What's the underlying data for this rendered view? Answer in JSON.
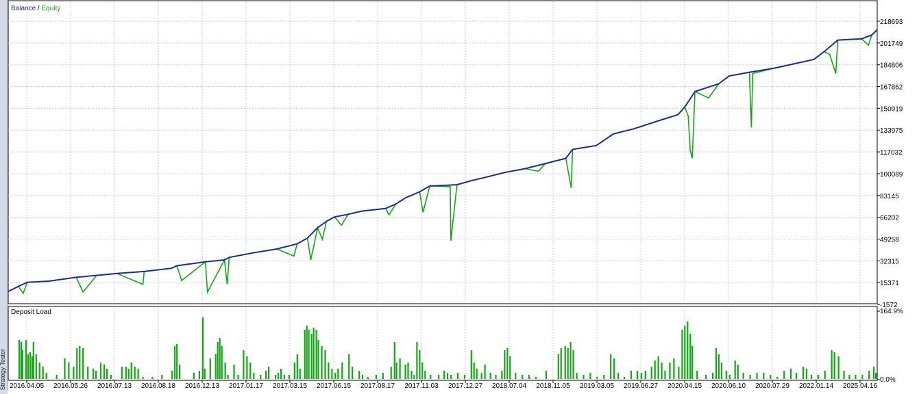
{
  "side_label": "Strategy Tester",
  "colors": {
    "balance": "#1d2d8f",
    "equity": "#12a812",
    "grid": "#c8c8c8",
    "axis": "#000000",
    "background": "#ffffff"
  },
  "chart_data": [
    {
      "type": "line",
      "legend": {
        "balance_label": "Balance",
        "separator": " / ",
        "equity_label": "Equity",
        "placement": "top-left"
      },
      "y_ticks": [
        "218693",
        "201749",
        "184806",
        "167862",
        "150919",
        "133975",
        "117032",
        "100089",
        "83145",
        "66202",
        "49258",
        "32315",
        "15371",
        "-1572"
      ],
      "ylim": [
        -1572,
        218693
      ],
      "grid": true,
      "series": [
        {
          "name": "Balance",
          "points": [
            [
              0,
              8500
            ],
            [
              15,
              12500
            ],
            [
              28,
              15600
            ],
            [
              60,
              16500
            ],
            [
              100,
              19500
            ],
            [
              130,
              21000
            ],
            [
              160,
              22500
            ],
            [
              200,
              24000
            ],
            [
              240,
              26500
            ],
            [
              248,
              28500
            ],
            [
              290,
              31500
            ],
            [
              318,
              33000
            ],
            [
              325,
              35000
            ],
            [
              360,
              38500
            ],
            [
              395,
              41500
            ],
            [
              425,
              45500
            ],
            [
              440,
              50000
            ],
            [
              455,
              58000
            ],
            [
              468,
              63000
            ],
            [
              480,
              66500
            ],
            [
              500,
              68500
            ],
            [
              520,
              71000
            ],
            [
              555,
              73000
            ],
            [
              570,
              76500
            ],
            [
              585,
              81500
            ],
            [
              605,
              86000
            ],
            [
              620,
              90500
            ],
            [
              660,
              91500
            ],
            [
              680,
              94500
            ],
            [
              700,
              97000
            ],
            [
              730,
              101000
            ],
            [
              760,
              104000
            ],
            [
              790,
              108000
            ],
            [
              820,
              112000
            ],
            [
              830,
              119000
            ],
            [
              865,
              122000
            ],
            [
              890,
              131000
            ],
            [
              920,
              135000
            ],
            [
              955,
              141000
            ],
            [
              985,
              146000
            ],
            [
              995,
              152000
            ],
            [
              1010,
              164000
            ],
            [
              1045,
              170000
            ],
            [
              1060,
              176000
            ],
            [
              1090,
              179000
            ],
            [
              1125,
              182000
            ],
            [
              1160,
              186000
            ],
            [
              1185,
              189000
            ],
            [
              1200,
              195000
            ],
            [
              1220,
              204000
            ],
            [
              1255,
              205000
            ],
            [
              1270,
              208000
            ],
            [
              1278,
              212000
            ]
          ]
        },
        {
          "name": "Equity",
          "points": [
            [
              0,
              8500
            ],
            [
              15,
              12500
            ],
            [
              22,
              7000
            ],
            [
              28,
              15600
            ],
            [
              60,
              16500
            ],
            [
              100,
              19500
            ],
            [
              110,
              8000
            ],
            [
              130,
              21000
            ],
            [
              160,
              22500
            ],
            [
              198,
              14000
            ],
            [
              200,
              24000
            ],
            [
              240,
              26500
            ],
            [
              248,
              28500
            ],
            [
              255,
              17000
            ],
            [
              290,
              31500
            ],
            [
              293,
              8000
            ],
            [
              318,
              33000
            ],
            [
              322,
              14000
            ],
            [
              325,
              35000
            ],
            [
              360,
              38500
            ],
            [
              395,
              41500
            ],
            [
              420,
              36000
            ],
            [
              425,
              45500
            ],
            [
              440,
              50000
            ],
            [
              445,
              33000
            ],
            [
              455,
              58000
            ],
            [
              462,
              49000
            ],
            [
              468,
              63000
            ],
            [
              480,
              66500
            ],
            [
              490,
              60000
            ],
            [
              500,
              68500
            ],
            [
              520,
              71000
            ],
            [
              555,
              73000
            ],
            [
              560,
              68000
            ],
            [
              570,
              76500
            ],
            [
              585,
              81500
            ],
            [
              605,
              86000
            ],
            [
              610,
              70000
            ],
            [
              620,
              90500
            ],
            [
              650,
              90000
            ],
            [
              651,
              48000
            ],
            [
              660,
              91500
            ],
            [
              680,
              94500
            ],
            [
              700,
              97000
            ],
            [
              730,
              101000
            ],
            [
              760,
              104000
            ],
            [
              780,
              102000
            ],
            [
              790,
              108000
            ],
            [
              820,
              112000
            ],
            [
              828,
              89000
            ],
            [
              830,
              119000
            ],
            [
              865,
              122000
            ],
            [
              890,
              131000
            ],
            [
              920,
              135000
            ],
            [
              955,
              141000
            ],
            [
              985,
              146000
            ],
            [
              995,
              152000
            ],
            [
              1000,
              145000
            ],
            [
              1003,
              118000
            ],
            [
              1006,
              112000
            ],
            [
              1010,
              164000
            ],
            [
              1030,
              159000
            ],
            [
              1045,
              170000
            ],
            [
              1060,
              176000
            ],
            [
              1090,
              179000
            ],
            [
              1093,
              136000
            ],
            [
              1095,
              178000
            ],
            [
              1125,
              182000
            ],
            [
              1160,
              186000
            ],
            [
              1185,
              189000
            ],
            [
              1200,
              195000
            ],
            [
              1208,
              193000
            ],
            [
              1217,
              178000
            ],
            [
              1220,
              204000
            ],
            [
              1255,
              205000
            ],
            [
              1265,
              200000
            ],
            [
              1270,
              208000
            ],
            [
              1278,
              212000
            ]
          ]
        }
      ]
    },
    {
      "type": "bar",
      "title": "Deposit Load",
      "y_ticks": [
        "164.9%",
        "0.0%"
      ],
      "ylim": [
        0,
        164.9
      ],
      "x_ticks": [
        "2016.04.05",
        "2016.05.26",
        "2016.07.13",
        "2016.08.18",
        "2016.12.13",
        "2017.01.17",
        "2017.03.15",
        "2017.06.15",
        "2017.08.17",
        "2017.11.03",
        "2017.12.27",
        "2018.07.04",
        "2018.11.05",
        "2019.03.05",
        "2019.06.27",
        "2020.04.15",
        "2020.06.10",
        "2020.07.29",
        "2022.01.14",
        "2025.04.16"
      ],
      "bars": [
        [
          15,
          95
        ],
        [
          18,
          90
        ],
        [
          20,
          70
        ],
        [
          25,
          95
        ],
        [
          28,
          60
        ],
        [
          31,
          65
        ],
        [
          34,
          55
        ],
        [
          36,
          90
        ],
        [
          40,
          60
        ],
        [
          45,
          40
        ],
        [
          50,
          30
        ],
        [
          55,
          15
        ],
        [
          70,
          10
        ],
        [
          82,
          50
        ],
        [
          88,
          40
        ],
        [
          95,
          30
        ],
        [
          100,
          75
        ],
        [
          104,
          80
        ],
        [
          109,
          75
        ],
        [
          116,
          30
        ],
        [
          124,
          25
        ],
        [
          128,
          20
        ],
        [
          135,
          40
        ],
        [
          140,
          35
        ],
        [
          144,
          25
        ],
        [
          150,
          10
        ],
        [
          166,
          30
        ],
        [
          172,
          30
        ],
        [
          176,
          25
        ],
        [
          180,
          40
        ],
        [
          185,
          30
        ],
        [
          190,
          25
        ],
        [
          197,
          5
        ],
        [
          211,
          5
        ],
        [
          225,
          10
        ],
        [
          240,
          20
        ],
        [
          244,
          80
        ],
        [
          247,
          85
        ],
        [
          251,
          35
        ],
        [
          272,
          15
        ],
        [
          280,
          20
        ],
        [
          285,
          150
        ],
        [
          288,
          25
        ],
        [
          296,
          50
        ],
        [
          304,
          60
        ],
        [
          307,
          90
        ],
        [
          310,
          100
        ],
        [
          313,
          80
        ],
        [
          318,
          40
        ],
        [
          322,
          10
        ],
        [
          331,
          35
        ],
        [
          337,
          10
        ],
        [
          345,
          70
        ],
        [
          350,
          55
        ],
        [
          355,
          40
        ],
        [
          360,
          15
        ],
        [
          370,
          10
        ],
        [
          378,
          20
        ],
        [
          382,
          30
        ],
        [
          392,
          10
        ],
        [
          396,
          15
        ],
        [
          400,
          25
        ],
        [
          405,
          10
        ],
        [
          412,
          10
        ],
        [
          420,
          40
        ],
        [
          424,
          60
        ],
        [
          428,
          25
        ],
        [
          435,
          120
        ],
        [
          438,
          130
        ],
        [
          441,
          120
        ],
        [
          445,
          110
        ],
        [
          448,
          125
        ],
        [
          452,
          120
        ],
        [
          455,
          95
        ],
        [
          460,
          80
        ],
        [
          465,
          70
        ],
        [
          470,
          40
        ],
        [
          475,
          25
        ],
        [
          480,
          15
        ],
        [
          484,
          25
        ],
        [
          490,
          40
        ],
        [
          500,
          60
        ],
        [
          505,
          30
        ],
        [
          515,
          20
        ],
        [
          520,
          10
        ],
        [
          528,
          5
        ],
        [
          540,
          10
        ],
        [
          550,
          15
        ],
        [
          562,
          30
        ],
        [
          567,
          90
        ],
        [
          570,
          40
        ],
        [
          575,
          50
        ],
        [
          583,
          35
        ],
        [
          587,
          40
        ],
        [
          592,
          20
        ],
        [
          596,
          10
        ],
        [
          600,
          90
        ],
        [
          604,
          70
        ],
        [
          608,
          40
        ],
        [
          612,
          20
        ],
        [
          620,
          10
        ],
        [
          632,
          10
        ],
        [
          640,
          20
        ],
        [
          645,
          15
        ],
        [
          650,
          10
        ],
        [
          660,
          15
        ],
        [
          670,
          10
        ],
        [
          680,
          70
        ],
        [
          684,
          40
        ],
        [
          688,
          25
        ],
        [
          695,
          15
        ],
        [
          700,
          35
        ],
        [
          708,
          15
        ],
        [
          716,
          10
        ],
        [
          725,
          20
        ],
        [
          729,
          70
        ],
        [
          733,
          75
        ],
        [
          737,
          55
        ],
        [
          745,
          15
        ],
        [
          755,
          10
        ],
        [
          765,
          10
        ],
        [
          775,
          5
        ],
        [
          790,
          20
        ],
        [
          808,
          60
        ],
        [
          812,
          75
        ],
        [
          818,
          80
        ],
        [
          822,
          75
        ],
        [
          826,
          90
        ],
        [
          830,
          70
        ],
        [
          835,
          15
        ],
        [
          845,
          10
        ],
        [
          855,
          15
        ],
        [
          865,
          5
        ],
        [
          875,
          10
        ],
        [
          885,
          60
        ],
        [
          890,
          50
        ],
        [
          896,
          15
        ],
        [
          905,
          5
        ],
        [
          915,
          20
        ],
        [
          924,
          20
        ],
        [
          930,
          15
        ],
        [
          936,
          20
        ],
        [
          945,
          30
        ],
        [
          950,
          45
        ],
        [
          955,
          55
        ],
        [
          960,
          40
        ],
        [
          965,
          20
        ],
        [
          972,
          40
        ],
        [
          978,
          50
        ],
        [
          985,
          30
        ],
        [
          990,
          120
        ],
        [
          994,
          130
        ],
        [
          998,
          140
        ],
        [
          1002,
          110
        ],
        [
          1005,
          80
        ],
        [
          1012,
          20
        ],
        [
          1025,
          10
        ],
        [
          1035,
          15
        ],
        [
          1040,
          75
        ],
        [
          1044,
          60
        ],
        [
          1048,
          40
        ],
        [
          1055,
          20
        ],
        [
          1060,
          10
        ],
        [
          1068,
          45
        ],
        [
          1072,
          35
        ],
        [
          1080,
          15
        ],
        [
          1090,
          10
        ],
        [
          1100,
          15
        ],
        [
          1110,
          15
        ],
        [
          1120,
          10
        ],
        [
          1130,
          5
        ],
        [
          1140,
          20
        ],
        [
          1150,
          25
        ],
        [
          1158,
          15
        ],
        [
          1168,
          30
        ],
        [
          1173,
          25
        ],
        [
          1180,
          10
        ],
        [
          1190,
          10
        ],
        [
          1200,
          20
        ],
        [
          1210,
          70
        ],
        [
          1214,
          65
        ],
        [
          1220,
          55
        ],
        [
          1228,
          20
        ],
        [
          1236,
          10
        ],
        [
          1245,
          10
        ],
        [
          1255,
          10
        ],
        [
          1265,
          20
        ],
        [
          1272,
          30
        ],
        [
          1275,
          15
        ]
      ]
    }
  ]
}
